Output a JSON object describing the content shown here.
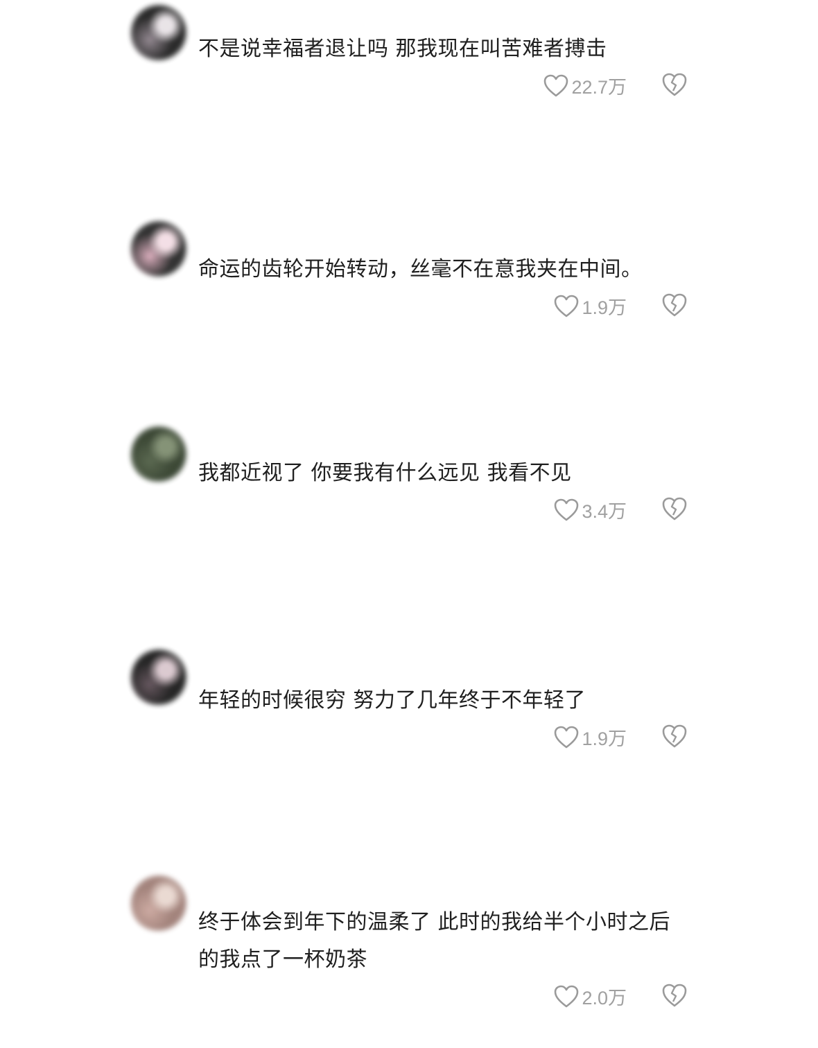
{
  "comments": [
    {
      "text": "不是说幸福者退让吗 那我现在叫苦难者搏击",
      "likes": "22.7万",
      "avatar_colors": [
        "#1a1a1a",
        "#8a7f88",
        "#e8e2e6"
      ]
    },
    {
      "text": "命运的齿轮开始转动，丝毫不在意我夹在中间。",
      "likes": "1.9万",
      "avatar_colors": [
        "#222222",
        "#d8a8b8",
        "#f3dde4"
      ]
    },
    {
      "text": "我都近视了 你要我有什么远见 我看不见",
      "likes": "3.4万",
      "avatar_colors": [
        "#2d3a26",
        "#4d5c42",
        "#7b8a6c"
      ]
    },
    {
      "text": "年轻的时候很穷 努力了几年终于不年轻了",
      "likes": "1.9万",
      "avatar_colors": [
        "#141414",
        "#5a4a52",
        "#d9c6cd"
      ]
    },
    {
      "text": "终于体会到年下的温柔了 此时的我给半个小时之后的我点了一杯奶茶",
      "likes": "2.0万",
      "avatar_colors": [
        "#9c7a72",
        "#c9a49b",
        "#e9d7cf"
      ]
    }
  ],
  "icons": {
    "like": "heart-outline-icon",
    "dislike": "broken-heart-icon"
  },
  "colors": {
    "text": "#1f1f1f",
    "muted": "#a0a0a0",
    "background": "#ffffff"
  }
}
